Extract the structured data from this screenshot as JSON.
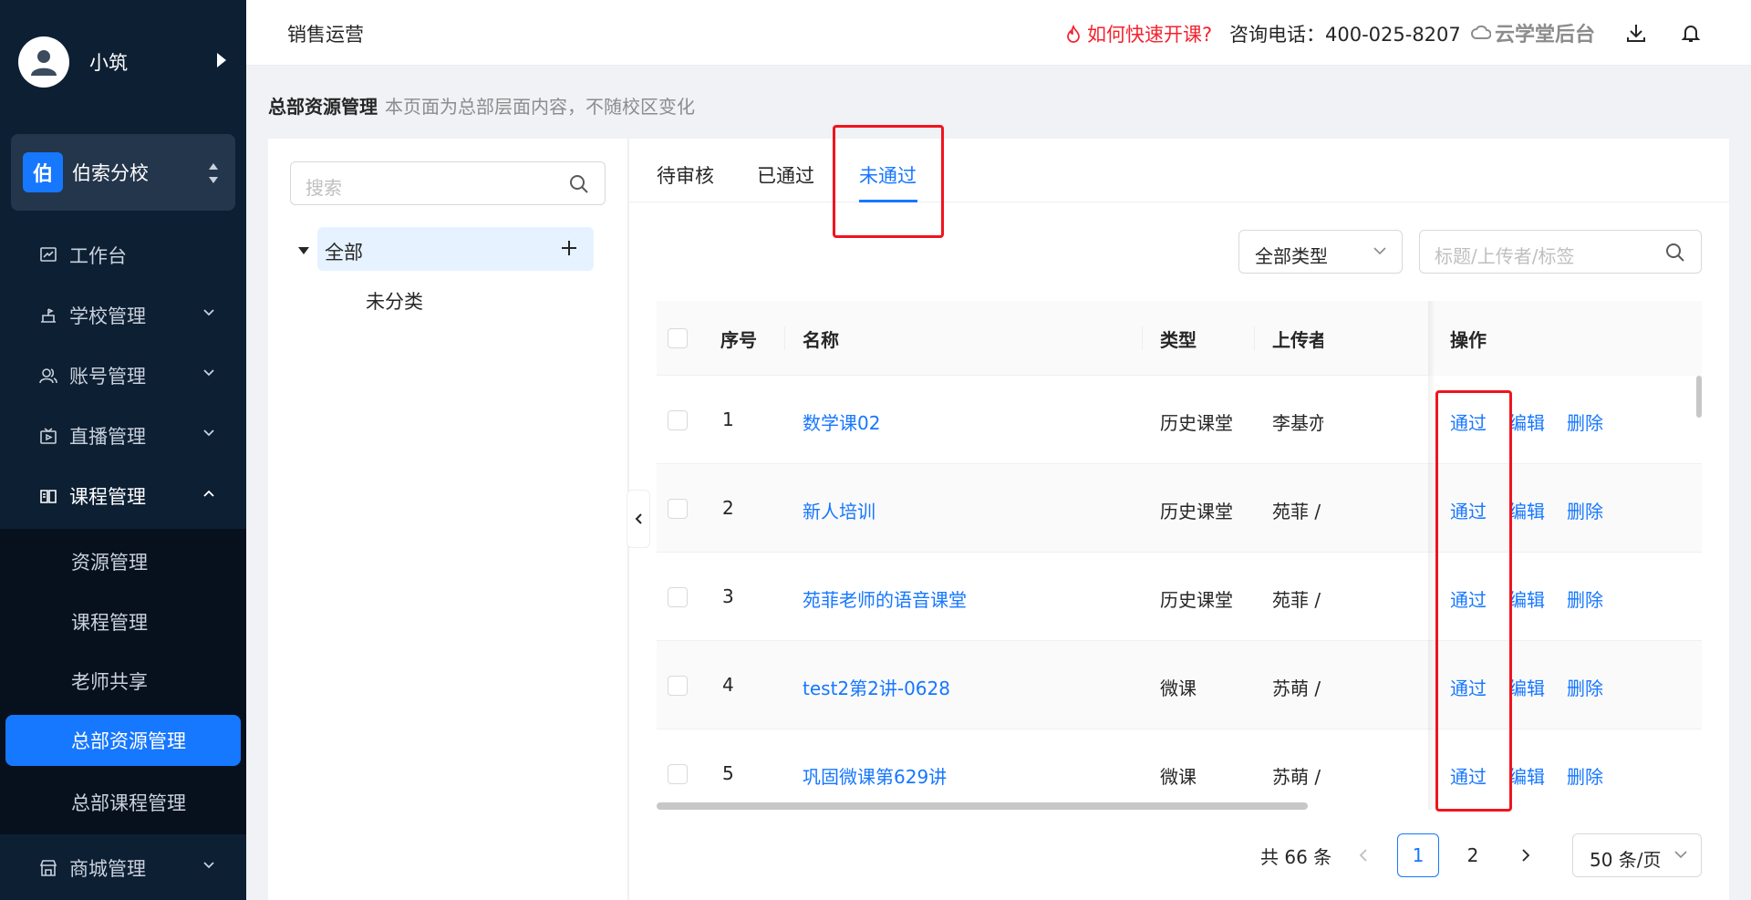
{
  "sidebar": {
    "user_name": "小筑",
    "school": {
      "badge": "伯",
      "name": "伯索分校"
    },
    "menu": [
      {
        "label": "工作台",
        "icon": "dashboard-icon"
      },
      {
        "label": "学校管理",
        "icon": "school-icon"
      },
      {
        "label": "账号管理",
        "icon": "users-icon"
      },
      {
        "label": "直播管理",
        "icon": "live-icon"
      },
      {
        "label": "课程管理",
        "icon": "book-icon"
      },
      {
        "label": "商城管理",
        "icon": "store-icon"
      }
    ],
    "submenu": [
      "资源管理",
      "课程管理",
      "老师共享",
      "总部资源管理",
      "总部课程管理"
    ]
  },
  "topbar": {
    "title": "销售运营",
    "quick_start": "如何快速开课?",
    "phone": "咨询电话：400-025-8207",
    "brand": "云学堂后台"
  },
  "page": {
    "title": "总部资源管理",
    "desc": "本页面为总部层面内容，不随校区变化"
  },
  "tree": {
    "search_placeholder": "搜索",
    "root": "全部",
    "children": [
      "未分类"
    ]
  },
  "tabs": [
    "待审核",
    "已通过",
    "未通过"
  ],
  "filters": {
    "type_value": "全部类型",
    "search_placeholder": "标题/上传者/标签"
  },
  "table": {
    "columns": {
      "index": "序号",
      "name": "名称",
      "type": "类型",
      "uploader": "上传者",
      "ops": "操作"
    },
    "rows": [
      {
        "index": "1",
        "name": "数学课02",
        "type": "历史课堂",
        "uploader": "李基亦"
      },
      {
        "index": "2",
        "name": "新人培训",
        "type": "历史课堂",
        "uploader": "苑菲 /"
      },
      {
        "index": "3",
        "name": "苑菲老师的语音课堂",
        "type": "历史课堂",
        "uploader": "苑菲 /"
      },
      {
        "index": "4",
        "name": "test2第2讲-0628",
        "type": "微课",
        "uploader": "苏萌 /"
      },
      {
        "index": "5",
        "name": "巩固微课第629讲",
        "type": "微课",
        "uploader": "苏萌 /"
      }
    ],
    "ops": {
      "approve": "通过",
      "edit": "编辑",
      "delete": "删除"
    }
  },
  "pagination": {
    "total": "共 66 条",
    "pages": [
      "1",
      "2"
    ],
    "page_size": "50 条/页"
  },
  "colors": {
    "primary": "#1677ff",
    "sidebar_bg": "#0d1f33",
    "annotation": "#f0141e",
    "warning": "#f5222d"
  }
}
